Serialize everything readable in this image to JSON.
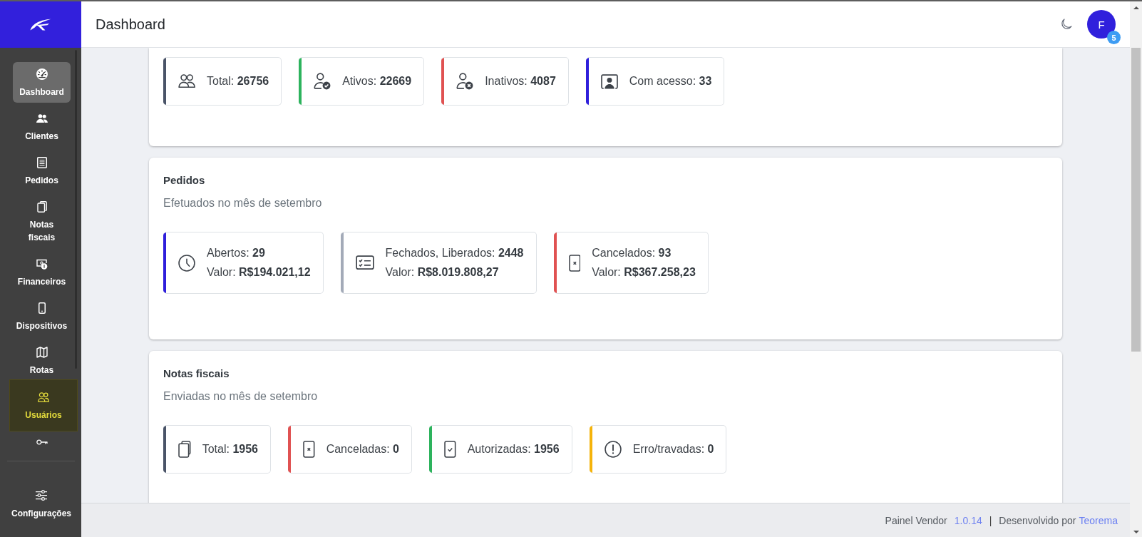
{
  "header": {
    "title": "Dashboard",
    "avatar": {
      "initial": "F",
      "badge": "5"
    }
  },
  "sidebar": {
    "items": [
      {
        "label": "Dashboard",
        "selected": true,
        "highlighted": false
      },
      {
        "label": "Clientes",
        "selected": false,
        "highlighted": false
      },
      {
        "label": "Pedidos",
        "selected": false,
        "highlighted": false
      },
      {
        "label": "Notas fiscais",
        "selected": false,
        "highlighted": false
      },
      {
        "label": "Financeiros",
        "selected": false,
        "highlighted": false
      },
      {
        "label": "Dispositivos",
        "selected": false,
        "highlighted": false
      },
      {
        "label": "Rotas",
        "selected": false,
        "highlighted": false
      },
      {
        "label": "Usuários",
        "selected": false,
        "highlighted": true
      },
      {
        "selected": false,
        "highlighted": false
      }
    ],
    "footer_items": [
      {
        "label": "Configurações",
        "selected": false
      }
    ]
  },
  "sections": [
    {
      "stats": [
        {
          "color": "#4a5468",
          "lines": [
            "Total: **26756**"
          ]
        },
        {
          "color": "#2db35d",
          "lines": [
            "Ativos: **22669**"
          ]
        },
        {
          "color": "#e05252",
          "lines": [
            "Inativos: **4087**"
          ]
        },
        {
          "color": "#2f1fdb",
          "lines": [
            "Com acesso: **33**"
          ]
        }
      ]
    },
    {
      "title": "Pedidos",
      "subtitle": "Efetuados no mês de setembro",
      "stats": [
        {
          "color": "#2f1fdb",
          "lines": [
            "Abertos: **29**",
            "Valor: **R$194.021,12**"
          ]
        },
        {
          "color": "#a3aab8",
          "lines": [
            "Fechados, Liberados: **2448**",
            "Valor: **R$8.019.808,27**"
          ]
        },
        {
          "color": "#e05252",
          "lines": [
            "Cancelados: **93**",
            "Valor: **R$367.258,23**"
          ]
        }
      ]
    },
    {
      "title": "Notas fiscais",
      "subtitle": "Enviadas no mês de setembro",
      "stats": [
        {
          "color": "#4a5468",
          "lines": [
            "Total: **1956**"
          ]
        },
        {
          "color": "#e05252",
          "lines": [
            "Canceladas: **0**"
          ]
        },
        {
          "color": "#2db35d",
          "lines": [
            "Autorizadas: **1956**"
          ]
        },
        {
          "color": "#f5b30a",
          "lines": [
            "Erro/travadas: **0**"
          ]
        }
      ]
    }
  ],
  "footer": {
    "app_name": "Painel Vendor",
    "version": "1.0.14",
    "separator": "|",
    "credit": "Desenvolvido por",
    "company": "Teorema"
  }
}
